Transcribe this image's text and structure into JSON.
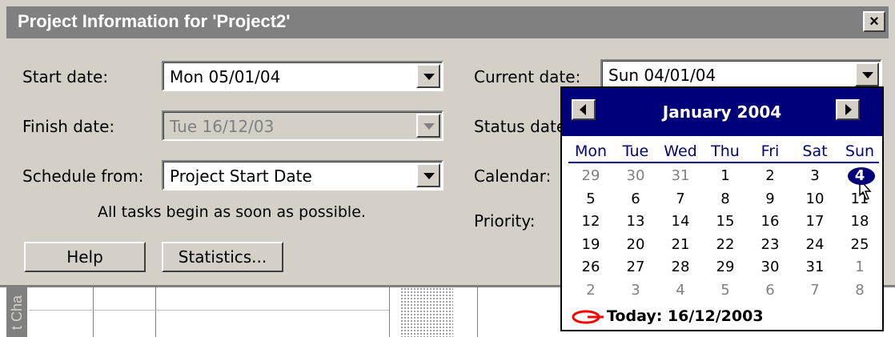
{
  "dialog": {
    "title": "Project Information for 'Project2'",
    "close_label": "×"
  },
  "left": {
    "start_date": {
      "label": "Start date:",
      "value": "Mon 05/01/04"
    },
    "finish_date": {
      "label": "Finish date:",
      "value": "Tue 16/12/03"
    },
    "schedule_from": {
      "label": "Schedule from:",
      "value": "Project Start Date"
    },
    "note": "All tasks begin as soon as possible."
  },
  "right": {
    "current_date": {
      "label": "Current date:",
      "value": "Sun 04/01/04"
    },
    "status_date": {
      "label": "Status date:"
    },
    "calendar": {
      "label": "Calendar:"
    },
    "priority": {
      "label": "Priority:"
    }
  },
  "buttons": {
    "help": "Help",
    "statistics": "Statistics..."
  },
  "gantt": {
    "side_label": "t Cha"
  },
  "calendar_popup": {
    "month_title": "January 2004",
    "weekdays": [
      "Mon",
      "Tue",
      "Wed",
      "Thu",
      "Fri",
      "Sat",
      "Sun"
    ],
    "weeks": [
      [
        "29",
        "30",
        "31",
        "1",
        "2",
        "3",
        "4"
      ],
      [
        "5",
        "6",
        "7",
        "8",
        "9",
        "10",
        "11"
      ],
      [
        "12",
        "13",
        "14",
        "15",
        "16",
        "17",
        "18"
      ],
      [
        "19",
        "20",
        "21",
        "22",
        "23",
        "24",
        "25"
      ],
      [
        "26",
        "27",
        "28",
        "29",
        "30",
        "31",
        "1"
      ],
      [
        "2",
        "3",
        "4",
        "5",
        "6",
        "7",
        "8"
      ]
    ],
    "selected_day": "4",
    "today_label": "Today: 16/12/2003",
    "colors": {
      "header": "#00007b",
      "today_mark": "#ff0000"
    }
  }
}
